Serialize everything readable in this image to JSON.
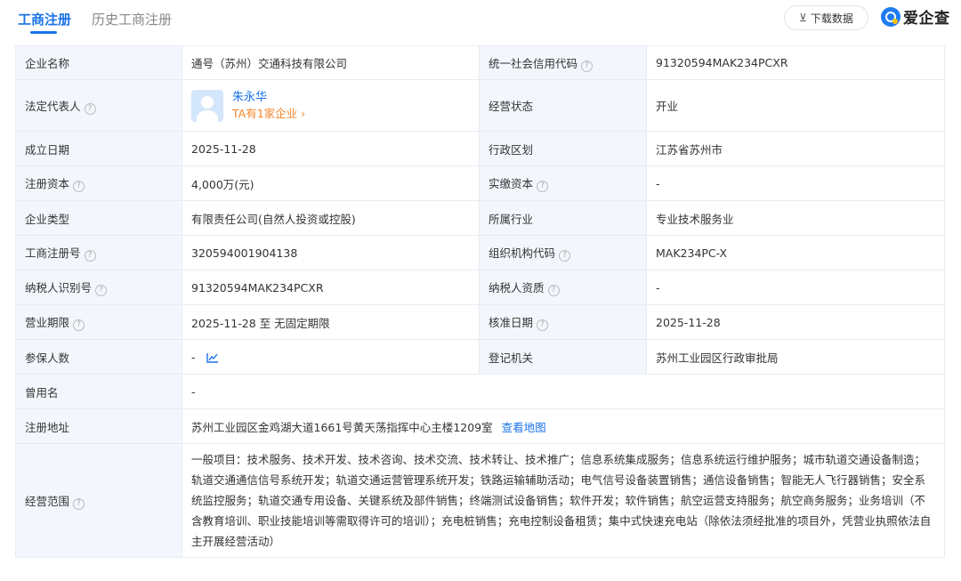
{
  "tabs": [
    {
      "label": "工商注册"
    },
    {
      "label": "历史工商注册"
    }
  ],
  "toolbar": {
    "download_label": "下载数据",
    "brand_label": "爱企查"
  },
  "colors": {
    "accent": "#1a73e8",
    "orange": "#f5852b",
    "label_bg": "#f3f7fd",
    "border": "#e8ecf2"
  },
  "fields": {
    "company_name": {
      "label": "企业名称",
      "value": "通号（苏州）交通科技有限公司"
    },
    "credit_code": {
      "label": "统一社会信用代码",
      "value": "91320594MAK234PCXR"
    },
    "legal_rep": {
      "label": "法定代表人",
      "name": "朱永华",
      "link": "TA有1家企业 ›"
    },
    "status": {
      "label": "经营状态",
      "value": "开业"
    },
    "founded": {
      "label": "成立日期",
      "value": "2025-11-28"
    },
    "region": {
      "label": "行政区划",
      "value": "江苏省苏州市"
    },
    "reg_capital": {
      "label": "注册资本",
      "value": "4,000万(元)"
    },
    "paid_capital": {
      "label": "实缴资本",
      "value": "-"
    },
    "company_type": {
      "label": "企业类型",
      "value": "有限责任公司(自然人投资或控股)"
    },
    "industry": {
      "label": "所属行业",
      "value": "专业技术服务业"
    },
    "reg_number": {
      "label": "工商注册号",
      "value": "320594001904138"
    },
    "org_code": {
      "label": "组织机构代码",
      "value": "MAK234PC-X"
    },
    "taxpayer_id": {
      "label": "纳税人识别号",
      "value": "91320594MAK234PCXR"
    },
    "taxpayer_qual": {
      "label": "纳税人资质",
      "value": "-"
    },
    "term": {
      "label": "营业期限",
      "value": "2025-11-28 至 无固定期限"
    },
    "approval_date": {
      "label": "核准日期",
      "value": "2025-11-28"
    },
    "insured": {
      "label": "参保人数",
      "value": "-"
    },
    "authority": {
      "label": "登记机关",
      "value": "苏州工业园区行政审批局"
    },
    "former_name": {
      "label": "曾用名",
      "value": "-"
    },
    "address": {
      "label": "注册地址",
      "value": "苏州工业园区金鸡湖大道1661号黄天荡指挥中心主楼1209室",
      "map_link": "查看地图"
    },
    "scope": {
      "label": "经营范围",
      "value": "一般项目：技术服务、技术开发、技术咨询、技术交流、技术转让、技术推广；信息系统集成服务；信息系统运行维护服务；城市轨道交通设备制造；轨道交通通信信号系统开发；轨道交通运营管理系统开发；铁路运输辅助活动；电气信号设备装置销售；通信设备销售；智能无人飞行器销售；安全系统监控服务；轨道交通专用设备、关键系统及部件销售；终端测试设备销售；软件开发；软件销售；航空运营支持服务；航空商务服务；业务培训（不含教育培训、职业技能培训等需取得许可的培训）；充电桩销售；充电控制设备租赁；集中式快速充电站（除依法须经批准的项目外，凭营业执照依法自主开展经营活动）"
    }
  }
}
